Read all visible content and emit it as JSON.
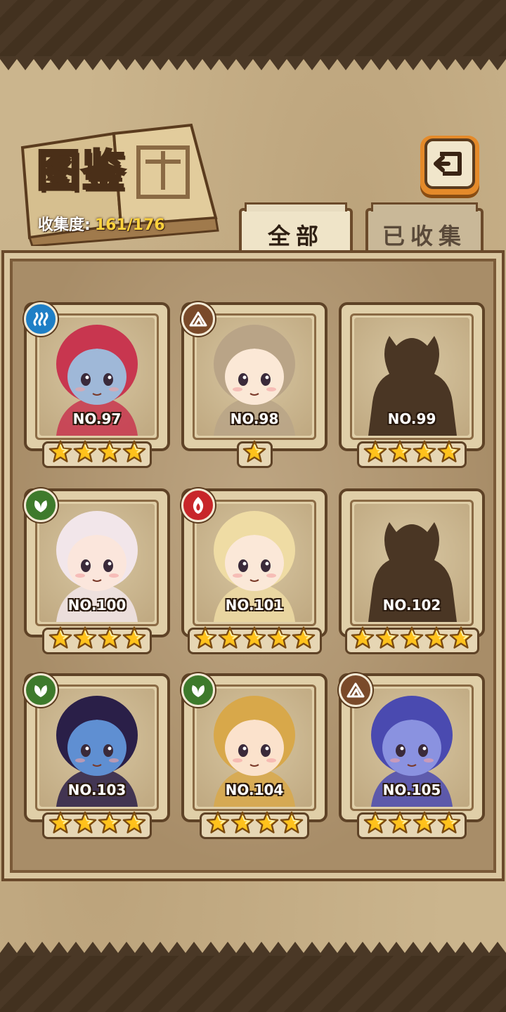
{
  "header": {
    "title": "图鉴",
    "collection_label": "收集度:",
    "collection_value": "161/176"
  },
  "tabs": [
    {
      "label": "全部",
      "active": true
    },
    {
      "label": "已收集",
      "active": false
    }
  ],
  "cards": [
    {
      "number": "NO.97",
      "stars": 4,
      "element": "water",
      "silhouette": false,
      "hair": "#c8364f",
      "skin": "#9fb8d8"
    },
    {
      "number": "NO.98",
      "stars": 1,
      "element": "earth",
      "silhouette": false,
      "hair": "#b9a487",
      "skin": "#fbe8d6"
    },
    {
      "number": "NO.99",
      "stars": 4,
      "element": "",
      "silhouette": true
    },
    {
      "number": "NO.100",
      "stars": 4,
      "element": "wood",
      "silhouette": false,
      "hair": "#f2e6ea",
      "skin": "#fbe6dc"
    },
    {
      "number": "NO.101",
      "stars": 5,
      "element": "fire",
      "silhouette": false,
      "hair": "#efdca4",
      "skin": "#fbe8d8"
    },
    {
      "number": "NO.102",
      "stars": 5,
      "element": "",
      "silhouette": true
    },
    {
      "number": "NO.103",
      "stars": 4,
      "element": "wood",
      "silhouette": false,
      "hair": "#2a1f48",
      "skin": "#5f8fd2"
    },
    {
      "number": "NO.104",
      "stars": 4,
      "element": "wood",
      "silhouette": false,
      "hair": "#d8a84a",
      "skin": "#fbe2cc"
    },
    {
      "number": "NO.105",
      "stars": 4,
      "element": "earth",
      "silhouette": false,
      "hair": "#4a4ab0",
      "skin": "#8a92e0"
    }
  ]
}
